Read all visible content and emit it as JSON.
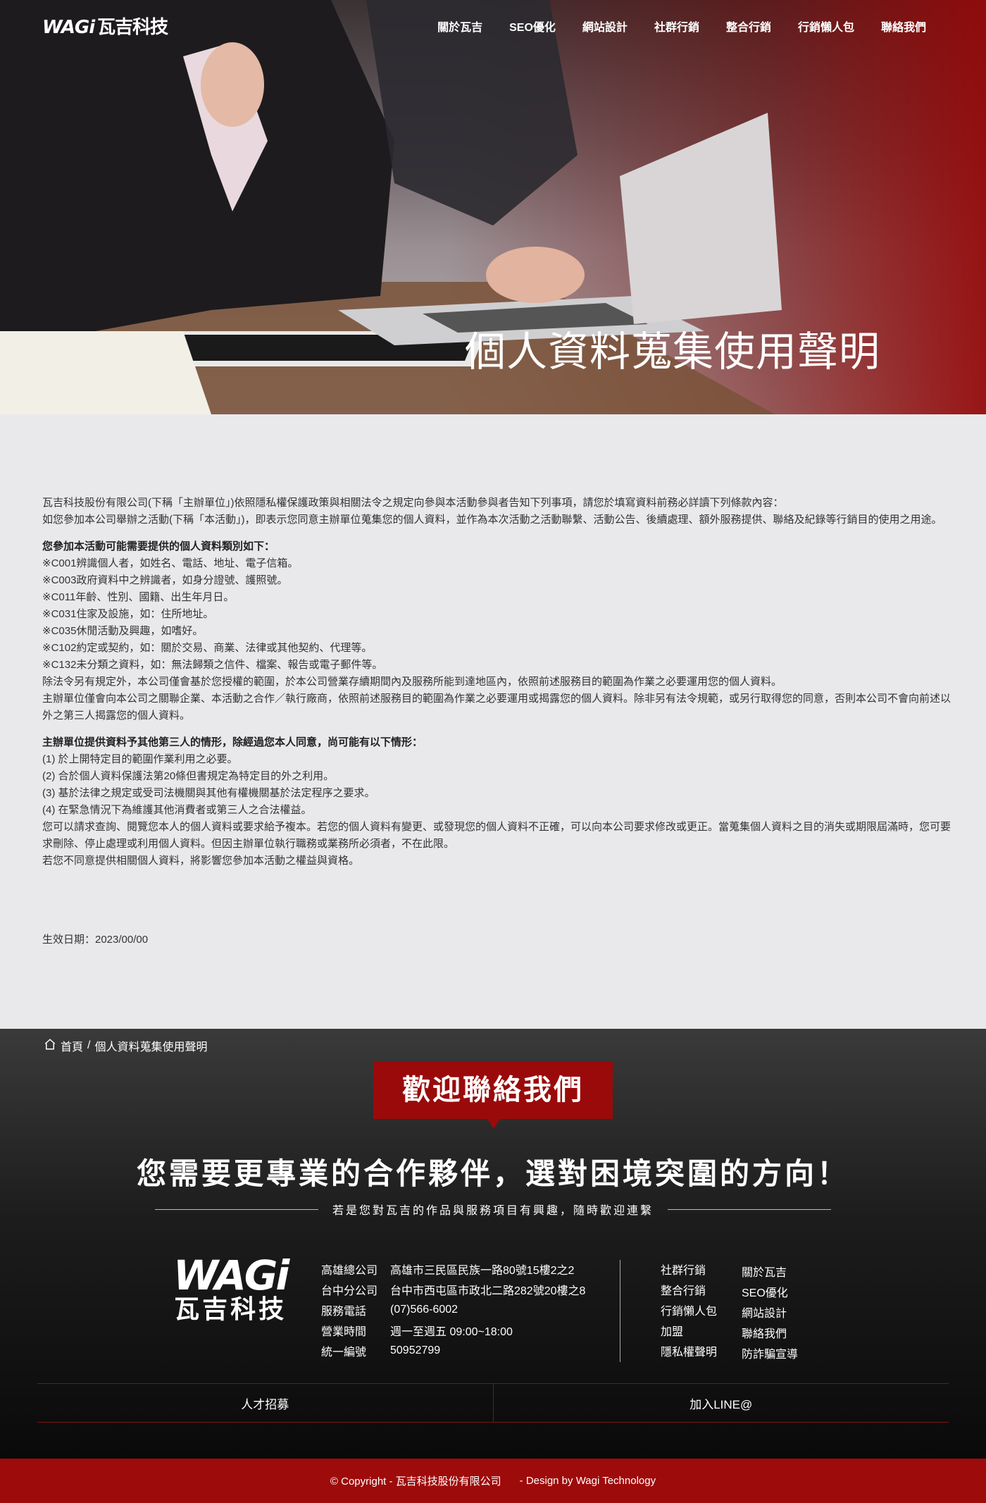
{
  "brand": {
    "logo_text": "WAGi",
    "logo_cn": "瓦吉科技"
  },
  "nav": {
    "items": [
      "關於瓦吉",
      "SEO優化",
      "網站設計",
      "社群行銷",
      "整合行銷",
      "行銷懶人包",
      "聯絡我們"
    ]
  },
  "hero": {
    "title": "個人資料蒐集使用聲明"
  },
  "content": {
    "intro_1": "瓦吉科技股份有限公司(下稱「主辦單位」)依照隱私權保護政策與相關法令之規定向參與本活動參與者告知下列事項，請您於填寫資料前務必詳讀下列條款內容：",
    "intro_2": "如您參加本公司舉辦之活動(下稱「本活動」)，即表示您同意主辦單位蒐集您的個人資料，並作為本次活動之活動聯繫、活動公告、後續處理、額外服務提供、聯絡及紀錄等行銷目的使用之用途。",
    "section1_title": "您參加本活動可能需要提供的個人資料類別如下：",
    "section1_items": [
      "※C001辨識個人者，如姓名、電話、地址、電子信箱。",
      "※C003政府資料中之辨識者，如身分證號、護照號。",
      "※C011年齡、性別、國籍、出生年月日。",
      "※C031住家及設施，如：住所地址。",
      "※C035休閒活動及興趣，如嗜好。",
      "※C102約定或契約，如：關於交易、商業、法律或其他契約、代理等。",
      "※C132未分類之資料，如：無法歸類之信件、檔案、報告或電子郵件等。"
    ],
    "section1_p1": "除法令另有規定外，本公司僅會基於您授權的範圍，於本公司營業存續期間內及服務所能到達地區內，依照前述服務目的範圍為作業之必要運用您的個人資料。",
    "section1_p2": "主辦單位僅會向本公司之關聯企業、本活動之合作／執行廠商，依照前述服務目的範圍為作業之必要運用或揭露您的個人資料。除非另有法令規範，或另行取得您的同意，否則本公司不會向前述以外之第三人揭露您的個人資料。",
    "section2_title": "主辦單位提供資料予其他第三人的情形，除經過您本人同意，尚可能有以下情形：",
    "section2_items": [
      "(1) 於上開特定目的範圍作業利用之必要。",
      "(2) 合於個人資料保護法第20條但書規定為特定目的外之利用。",
      "(3) 基於法律之規定或受司法機關與其他有權機關基於法定程序之要求。",
      "(4) 在緊急情況下為維護其他消費者或第三人之合法權益。"
    ],
    "section2_p1": "您可以請求查詢、閱覽您本人的個人資料或要求給予複本。若您的個人資料有變更、或發現您的個人資料不正確，可以向本公司要求修改或更正。當蒐集個人資料之目的消失或期限屆滿時，您可要求刪除、停止處理或利用個人資料。但因主辦單位執行職務或業務所必須者，不在此限。",
    "section2_p2": "若您不同意提供相關個人資料，將影響您參加本活動之權益與資格。",
    "effective_date": "生效日期：2023/00/00"
  },
  "breadcrumb": {
    "home": "首頁",
    "separator": "/",
    "current": "個人資料蒐集使用聲明"
  },
  "contact": {
    "welcome": "歡迎聯絡我們",
    "headline": "您需要更專業的合作夥伴，選對困境突圍的方向！",
    "subline": "若是您對瓦吉的作品與服務項目有興趣，隨時歡迎連繫"
  },
  "company_info": [
    {
      "label": "高雄總公司",
      "value": "高雄市三民區民族一路80號15樓2之2"
    },
    {
      "label": "台中分公司",
      "value": "台中市西屯區市政北二路282號20樓之8"
    },
    {
      "label": "服務電話",
      "value": "(07)566-6002"
    },
    {
      "label": "營業時間",
      "value": "週一至週五 09:00~18:00"
    },
    {
      "label": "統一編號",
      "value": "50952799"
    }
  ],
  "footer_links_col1": [
    "社群行銷",
    "整合行銷",
    "行銷懶人包",
    "加盟",
    "隱私權聲明"
  ],
  "footer_links_col2": [
    "關於瓦吉",
    "SEO優化",
    "網站設計",
    "聯絡我們",
    "防詐騙宣導"
  ],
  "bottom_links": {
    "recruit": "人才招募",
    "line": "加入LINE@"
  },
  "footer": {
    "copyright": "© Copyright - 瓦吉科技股份有限公司",
    "design": "-  Design by Wagi Technology"
  },
  "colors": {
    "brand_red": "#9e0b0b",
    "dark_bg": "#1c1c1c",
    "page_bg": "#e9e9ec"
  },
  "icons": {
    "breadcrumb_home": "home-icon"
  }
}
